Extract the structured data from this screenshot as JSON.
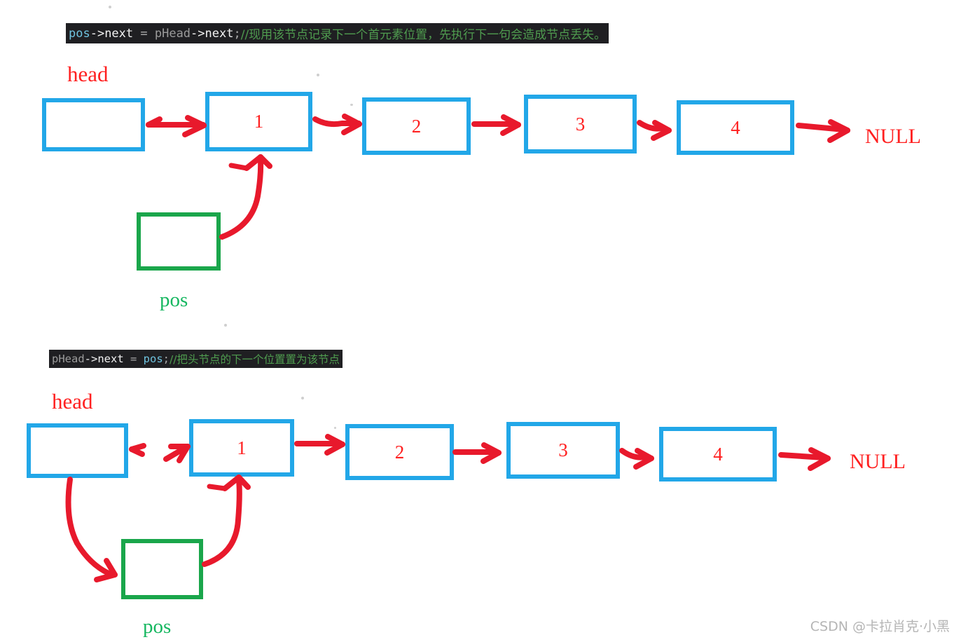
{
  "page": {
    "background": "#ffffff",
    "accent_blue": "#22a7e8",
    "accent_green": "#1aa64b",
    "accent_red": "#ff2020",
    "arrow_red": "#e8192c"
  },
  "watermark": "CSDN @卡拉肖克·小黑",
  "section_1": {
    "code": {
      "var": "pos",
      "arrow_member_1": "->next",
      "operator": " = ",
      "ident": "pHead",
      "arrow_member_2": "->next",
      "semicolon": ";",
      "comment": "//现用该节点记录下一个首元素位置，先执行下一句会造成节点丢失。"
    },
    "head_label": "head",
    "pos_label": "pos",
    "null_label": "NULL",
    "nodes": [
      {
        "value": "1"
      },
      {
        "value": "2"
      },
      {
        "value": "3"
      },
      {
        "value": "4"
      }
    ]
  },
  "section_2": {
    "code": {
      "ident": "pHead",
      "arrow_member_1": "->next",
      "operator": " = ",
      "var": "pos",
      "semicolon": ";",
      "comment": "//把头节点的下一个位置置为该节点"
    },
    "head_label": "head",
    "pos_label": "pos",
    "null_label": "NULL",
    "nodes": [
      {
        "value": "1"
      },
      {
        "value": "2"
      },
      {
        "value": "3"
      },
      {
        "value": "4"
      }
    ]
  }
}
